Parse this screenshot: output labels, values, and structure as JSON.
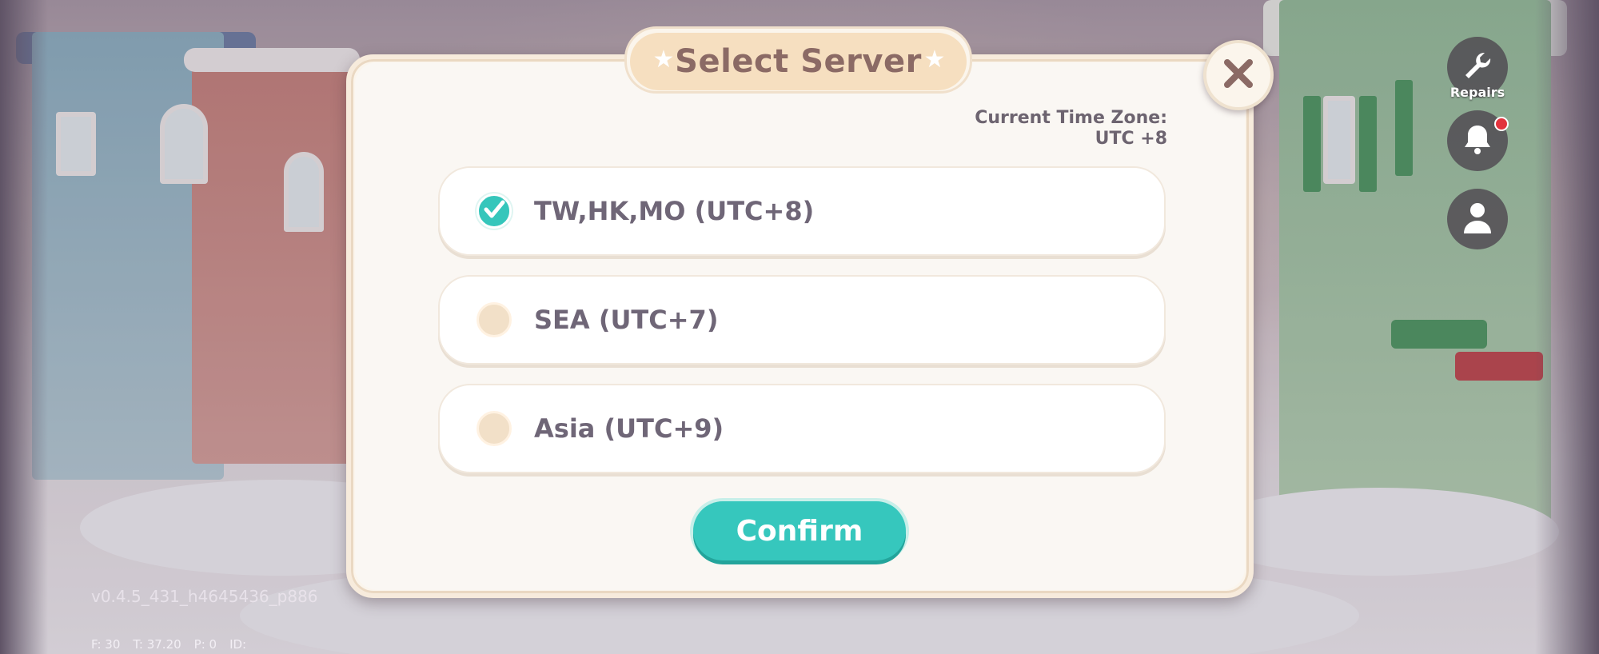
{
  "dialog": {
    "title": "Select Server",
    "current_time_zone_label": "Current Time Zone:",
    "current_time_zone_value": "UTC +8",
    "servers": [
      {
        "label": "TW,HK,MO (UTC+8)",
        "selected": true
      },
      {
        "label": "SEA (UTC+7)",
        "selected": false
      },
      {
        "label": "Asia (UTC+9)",
        "selected": false
      }
    ],
    "confirm_label": "Confirm"
  },
  "hud": {
    "repairs_label": "Repairs",
    "version": "v0.4.5_431_h4645436_p886",
    "stats": {
      "f": "F: 30",
      "t": "T: 37.20",
      "p": "P: 0",
      "id": "ID:"
    },
    "bell_has_notification": true
  },
  "icons": {
    "close": "close-icon",
    "check": "check-icon",
    "star": "star-icon",
    "repairs": "wrench-icon",
    "bell": "bell-icon",
    "profile": "person-icon"
  },
  "colors": {
    "accent_teal": "#36c7bd",
    "title_pill": "#f6dfc0",
    "title_text": "#8b6a65",
    "close_x": "#8b6a65",
    "notification_dot": "#e2333d"
  }
}
